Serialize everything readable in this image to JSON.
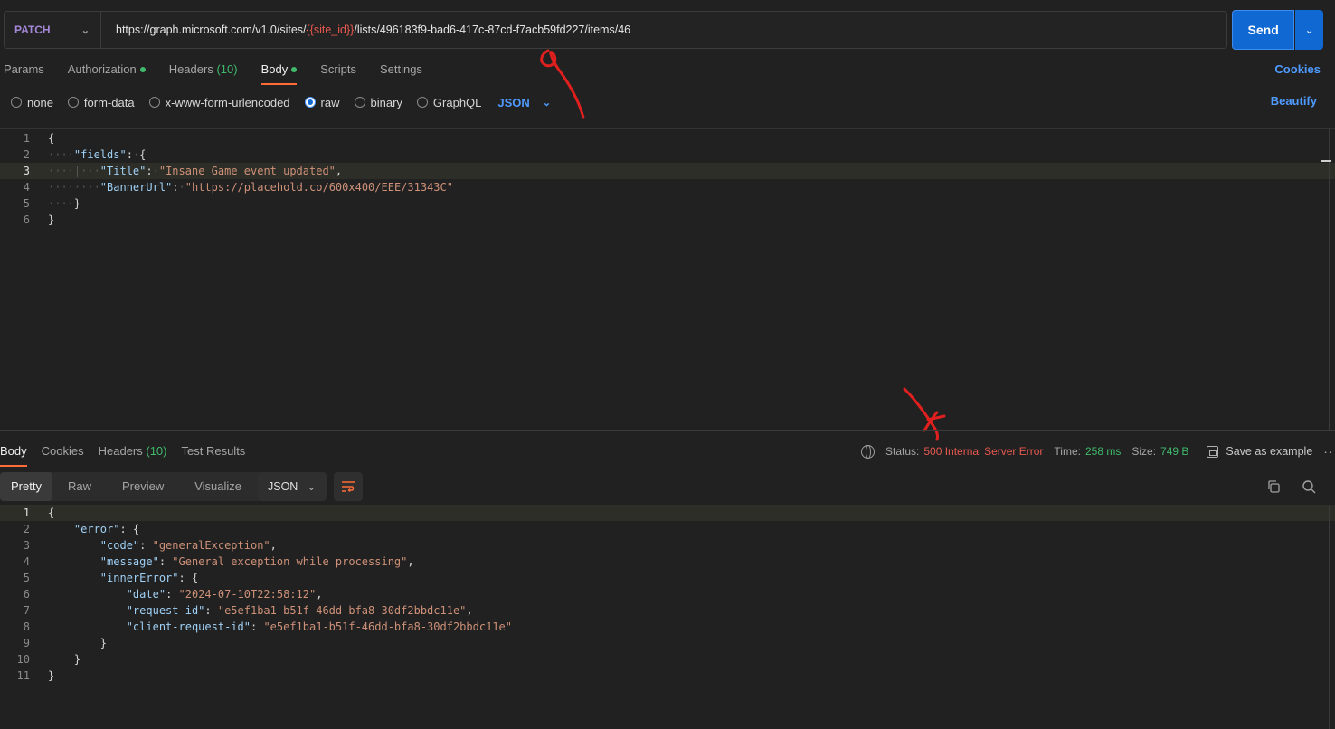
{
  "request": {
    "method": "PATCH",
    "url_prefix": "https://graph.microsoft.com/v1.0/sites/",
    "url_var": "{{site_id}}",
    "url_suffix": "/lists/496183f9-bad6-417c-87cd-f7acb59fd227/items/46",
    "send_label": "Send"
  },
  "req_tabs": {
    "params": "Params",
    "authorization": "Authorization",
    "headers": "Headers",
    "headers_count": "(10)",
    "body": "Body",
    "scripts": "Scripts",
    "settings": "Settings",
    "cookies": "Cookies"
  },
  "body_types": {
    "none": "none",
    "form_data": "form-data",
    "urlencoded": "x-www-form-urlencoded",
    "raw": "raw",
    "binary": "binary",
    "graphql": "GraphQL",
    "language": "JSON",
    "beautify": "Beautify"
  },
  "request_body": {
    "line_numbers": [
      "1",
      "2",
      "3",
      "4",
      "5",
      "6"
    ],
    "open": "{",
    "fields_key": "\"fields\"",
    "title_key": "\"Title\"",
    "title_value": "\"Insane Game event updated\"",
    "banner_key": "\"BannerUrl\"",
    "banner_value": "\"https://placehold.co/600x400/EEE/31343C\"",
    "close_inner": "}",
    "close": "}"
  },
  "resp_tabs": {
    "body": "Body",
    "cookies": "Cookies",
    "headers": "Headers",
    "headers_count": "(10)",
    "test_results": "Test Results"
  },
  "status": {
    "status_label": "Status:",
    "status_value": "500 Internal Server Error",
    "time_label": "Time:",
    "time_value": "258 ms",
    "size_label": "Size:",
    "size_value": "749 B",
    "save_example": "Save as example"
  },
  "view": {
    "pretty": "Pretty",
    "raw": "Raw",
    "preview": "Preview",
    "visualize": "Visualize",
    "format": "JSON"
  },
  "response_body": {
    "line_numbers": [
      "1",
      "2",
      "3",
      "4",
      "5",
      "6",
      "7",
      "8",
      "9",
      "10",
      "11"
    ],
    "open": "{",
    "error_key": "\"error\"",
    "code_key": "\"code\"",
    "code_value": "\"generalException\"",
    "message_key": "\"message\"",
    "message_value": "\"General exception while processing\"",
    "inner_key": "\"innerError\"",
    "date_key": "\"date\"",
    "date_value": "\"2024-07-10T22:58:12\"",
    "reqid_key": "\"request-id\"",
    "reqid_value": "\"e5ef1ba1-b51f-46dd-bfa8-30df2bbdc11e\"",
    "clientid_key": "\"client-request-id\"",
    "clientid_value": "\"e5ef1ba1-b51f-46dd-bfa8-30df2bbdc11e\"",
    "close_inner": "}",
    "close_error": "}",
    "close": "}"
  },
  "colors": {
    "accent": "#ff6c37",
    "link": "#4f9bff",
    "send": "#1068d3",
    "error": "#e8594f",
    "success": "#3fb96b",
    "annotation": "#e0201e"
  },
  "icons": [
    "chevron-down-icon",
    "globe-icon",
    "save-icon",
    "more-icon",
    "wrap-icon",
    "copy-icon",
    "search-icon"
  ]
}
